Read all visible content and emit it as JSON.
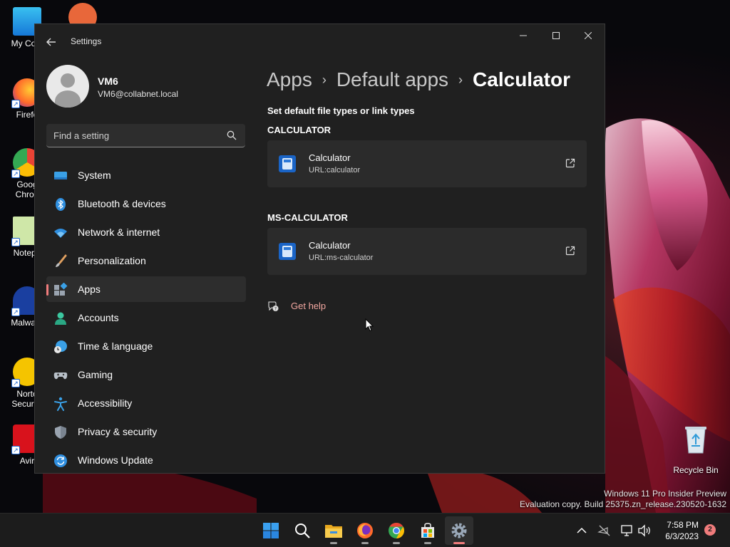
{
  "desktop": {
    "icons": [
      {
        "label": "My Com",
        "icon": "computer-icon"
      },
      {
        "label": "Firefo",
        "icon": "firefox-icon"
      },
      {
        "label": "Goog\nChron",
        "icon": "chrome-icon"
      },
      {
        "label": "Notepa",
        "icon": "notepad-icon"
      },
      {
        "label": "Malware",
        "icon": "malwarebytes-icon"
      },
      {
        "label": "Norto\nSecurity",
        "icon": "norton-icon"
      },
      {
        "label": "Avir",
        "icon": "avira-icon"
      }
    ],
    "recycle_bin_label": "Recycle Bin",
    "watermark_line1": "Windows 11 Pro Insider Preview",
    "watermark_line2": "Evaluation copy. Build 25375.zn_release.230520-1632"
  },
  "window": {
    "title": "Settings",
    "controls": {
      "minimize": "—",
      "maximize": "☐",
      "close": "✕"
    }
  },
  "profile": {
    "name": "VM6",
    "email": "VM6@collabnet.local"
  },
  "search": {
    "placeholder": "Find a setting"
  },
  "nav": {
    "items": [
      {
        "label": "System",
        "icon": "system-icon",
        "active": false
      },
      {
        "label": "Bluetooth & devices",
        "icon": "bluetooth-icon",
        "active": false
      },
      {
        "label": "Network & internet",
        "icon": "wifi-icon",
        "active": false
      },
      {
        "label": "Personalization",
        "icon": "brush-icon",
        "active": false
      },
      {
        "label": "Apps",
        "icon": "apps-icon",
        "active": true
      },
      {
        "label": "Accounts",
        "icon": "person-icon",
        "active": false
      },
      {
        "label": "Time & language",
        "icon": "clock-globe-icon",
        "active": false
      },
      {
        "label": "Gaming",
        "icon": "gamepad-icon",
        "active": false
      },
      {
        "label": "Accessibility",
        "icon": "accessibility-icon",
        "active": false
      },
      {
        "label": "Privacy & security",
        "icon": "shield-icon",
        "active": false
      },
      {
        "label": "Windows Update",
        "icon": "update-icon",
        "active": false
      }
    ]
  },
  "breadcrumb": {
    "items": [
      "Apps",
      "Default apps",
      "Calculator"
    ],
    "separator": "›"
  },
  "content": {
    "subtitle": "Set default file types or link types",
    "groups": [
      {
        "title": "CALCULATOR",
        "app_name": "Calculator",
        "url": "URL:calculator"
      },
      {
        "title": "MS-CALCULATOR",
        "app_name": "Calculator",
        "url": "URL:ms-calculator"
      }
    ],
    "help_label": "Get help"
  },
  "taskbar": {
    "apps": [
      "start-icon",
      "search-icon",
      "file-explorer-icon",
      "firefox-icon",
      "chrome-icon",
      "store-icon",
      "settings-icon"
    ],
    "time": "7:58 PM",
    "date": "6/3/2023",
    "notification_count": "2"
  },
  "colors": {
    "accent": "#f07c7c",
    "link": "#f2a7a0",
    "window_bg": "#202020",
    "card_bg": "#2b2b2b"
  }
}
